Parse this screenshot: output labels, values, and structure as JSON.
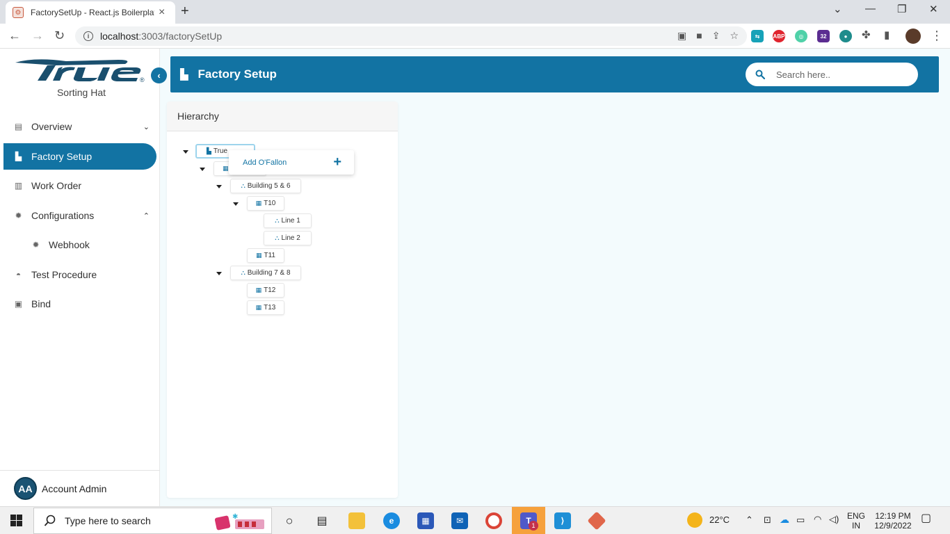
{
  "browser": {
    "tab_title": "FactorySetUp - React.js Boilerplat",
    "tab_close": "×",
    "new_tab": "+",
    "url_host": "localhost",
    "url_rest": ":3003/factorySetUp",
    "window_controls": [
      "⌄",
      "—",
      "❐",
      "✕"
    ]
  },
  "sidebar": {
    "logo_text": "True",
    "logo_reg": "®",
    "subtitle": "Sorting Hat",
    "collapse_symbol": "‹",
    "items": [
      {
        "label": "Overview",
        "icon": "overview-icon",
        "chevron": "⌄"
      },
      {
        "label": "Factory Setup",
        "icon": "factory-icon",
        "active": true
      },
      {
        "label": "Work Order",
        "icon": "clipboard-icon"
      },
      {
        "label": "Configurations",
        "icon": "gear-icon",
        "chevron": "⌃"
      },
      {
        "label": "Webhook",
        "icon": "gear-icon",
        "sub": true
      },
      {
        "label": "Test Procedure",
        "icon": "test-icon"
      },
      {
        "label": "Bind",
        "icon": "bind-icon"
      }
    ],
    "account": {
      "initials": "AA",
      "name": "Account Admin"
    }
  },
  "header": {
    "title": "Factory Setup",
    "search_placeholder": "Search here.."
  },
  "hierarchy": {
    "title": "Hierarchy",
    "nodes": [
      {
        "label": "True",
        "icon": "factory-icon"
      },
      {
        "label": "",
        "icon": "building-icon"
      },
      {
        "label": "Building 5 & 6",
        "icon": "sitemap-icon"
      },
      {
        "label": "T10",
        "icon": "building-icon"
      },
      {
        "label": "Line 1",
        "icon": "sitemap-icon"
      },
      {
        "label": "Line 2",
        "icon": "sitemap-icon"
      },
      {
        "label": "T11",
        "icon": "building-icon"
      },
      {
        "label": "Building 7 & 8",
        "icon": "sitemap-icon"
      },
      {
        "label": "T12",
        "icon": "building-icon"
      },
      {
        "label": "T13",
        "icon": "building-icon"
      }
    ],
    "popup": {
      "label": "Add O'Fallon",
      "plus": "+"
    }
  },
  "taskbar": {
    "search_text": "Type here to search",
    "weather": "22°C",
    "lang": "ENG",
    "region": "IN",
    "time": "12:19 PM",
    "date": "12/9/2022",
    "badge": "1"
  },
  "colors": {
    "primary": "#1273a3",
    "background": "#f3fbfd"
  }
}
